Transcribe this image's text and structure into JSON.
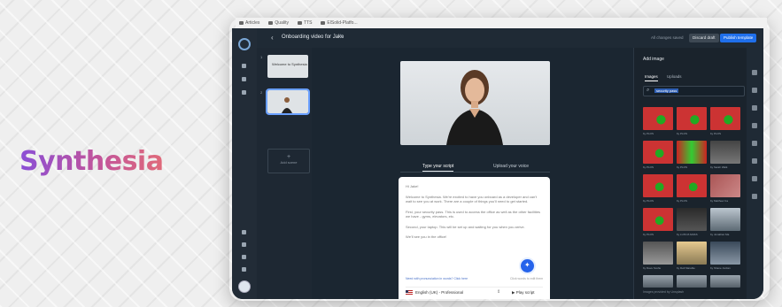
{
  "brand": {
    "logo_text": "Synthesia",
    "gradient": [
      "#8a4fd6",
      "#c2549b",
      "#e06a7a"
    ]
  },
  "browser": {
    "bookmarks": [
      "Articles",
      "Quality",
      "TTS",
      "ElSolid-Platfo..."
    ]
  },
  "app": {
    "title": "Onboarding video for Jake",
    "saved_status": "All changes saved",
    "buttons": {
      "draft": "Discard draft",
      "publish": "Publish template"
    },
    "scenes": [
      {
        "index": "1",
        "label": "Welcome to Synthesia"
      },
      {
        "index": "2",
        "label": ""
      }
    ],
    "add_scene": "Add scene",
    "script_tabs": {
      "type": "Type your script",
      "upload": "Upload your voice"
    },
    "script": {
      "greeting": "Hi Jake!",
      "p1": "Welcome to Synthesia. We're excited to have you onboard as a developer and can't wait to see you at work. There are a couple of things you'll need to get started.",
      "p2": "First, your security pass. This is used to access the office as well as the other facilities we have - gyms, elevators, etc.",
      "p3": "Second, your laptop. This will be set up and waiting for you when you arrive.",
      "p4": "We'll see you in the office!",
      "pron_link": "Need with pronunciation in words? Click here",
      "edit_note": "Click words to edit them",
      "language": "English (UK) - Professional",
      "play": "Play script"
    },
    "panel": {
      "title": "Add image",
      "tabs": {
        "images": "Images",
        "uploads": "Uploads"
      },
      "search_value": "security pass",
      "footer": "Images provided by Unsplash",
      "captions": [
        "by PLOS",
        "by PLOS",
        "by PLOS",
        "by PLOS",
        "by PLOS",
        "by Sarah Walk",
        "by PLOS",
        "by PLOS",
        "by Matthew Ca",
        "by PLOS",
        "by LUIS M ARIAS",
        "by Jonathan Ma",
        "by Dave Scofie",
        "by Dell Marable",
        "by Shane Jordan"
      ]
    }
  }
}
